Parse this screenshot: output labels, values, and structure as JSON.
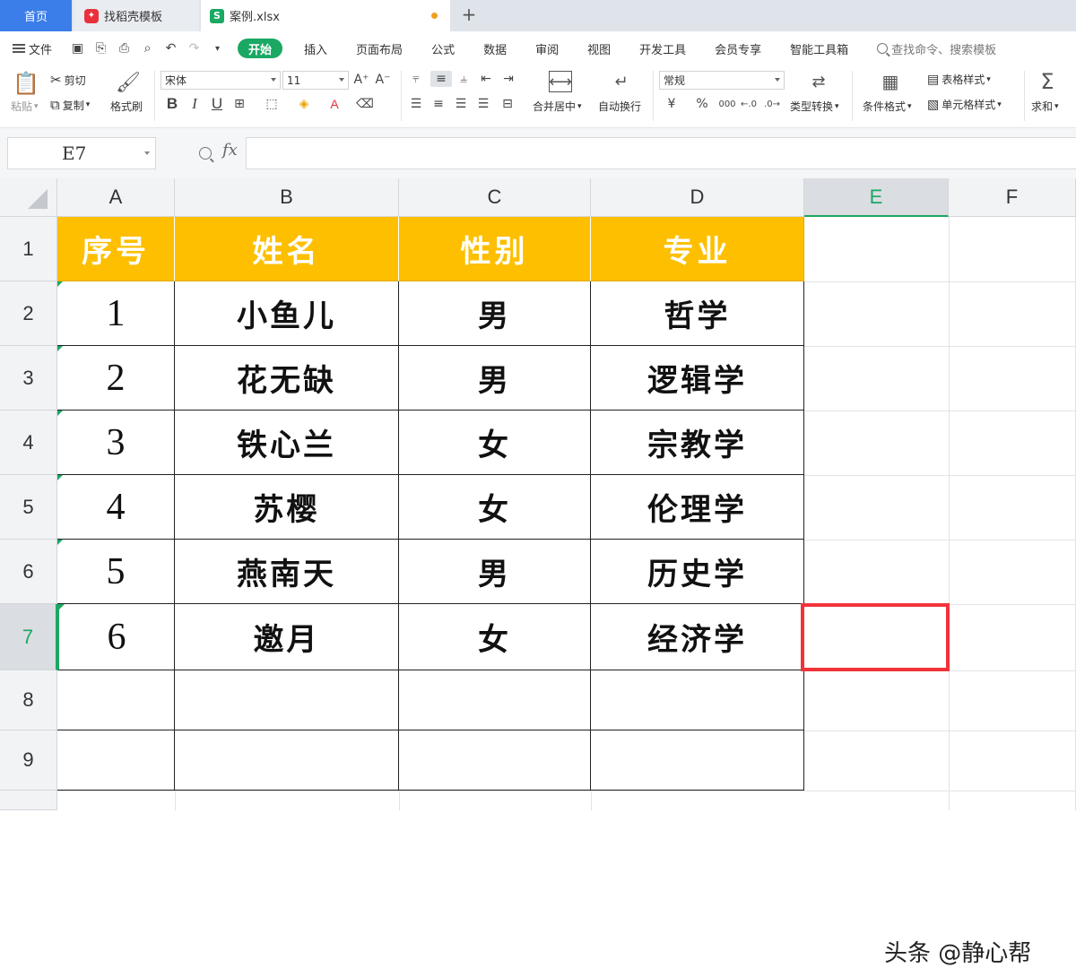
{
  "tabs": {
    "home": "首页",
    "templates": "找稻壳模板",
    "file": "案例.xlsx",
    "add": "+"
  },
  "menu": {
    "file": "文件",
    "tabs": [
      "开始",
      "插入",
      "页面布局",
      "公式",
      "数据",
      "审阅",
      "视图",
      "开发工具",
      "会员专享",
      "智能工具箱"
    ],
    "search_placeholder": "查找命令、搜索模板"
  },
  "ribbon": {
    "paste": "粘贴",
    "cut": "剪切",
    "copy": "复制",
    "format_painter": "格式刷",
    "font_name": "宋体",
    "font_size": "11",
    "bold": "B",
    "italic": "I",
    "underline": "U",
    "merge_center": "合并居中",
    "wrap_text": "自动换行",
    "number_format": "常规",
    "currency": "¥",
    "percent": "%",
    "thousands": "000",
    "type_convert": "类型转换",
    "conditional_format": "条件格式",
    "table_style": "表格样式",
    "cell_style": "单元格样式",
    "sum": "求和"
  },
  "formula_bar": {
    "name_box": "E7",
    "fx": "fx",
    "content": ""
  },
  "sheet": {
    "columns": [
      "A",
      "B",
      "C",
      "D",
      "E",
      "F"
    ],
    "selected_column": "E",
    "rows": [
      "1",
      "2",
      "3",
      "4",
      "5",
      "6",
      "7",
      "8",
      "9"
    ],
    "selected_row": "7",
    "header": [
      "序号",
      "姓名",
      "性别",
      "专业"
    ],
    "data": [
      [
        "1",
        "小鱼儿",
        "男",
        "哲学"
      ],
      [
        "2",
        "花无缺",
        "男",
        "逻辑学"
      ],
      [
        "3",
        "铁心兰",
        "女",
        "宗教学"
      ],
      [
        "4",
        "苏樱",
        "女",
        "伦理学"
      ],
      [
        "5",
        "燕南天",
        "男",
        "历史学"
      ],
      [
        "6",
        "邀月",
        "女",
        "经济学"
      ]
    ]
  },
  "watermark": "头条 @静心帮",
  "colors": {
    "accent": "#1aa863",
    "header_fill": "#fdbf00",
    "selection": "#f2333a",
    "home_tab": "#3b7de9"
  }
}
